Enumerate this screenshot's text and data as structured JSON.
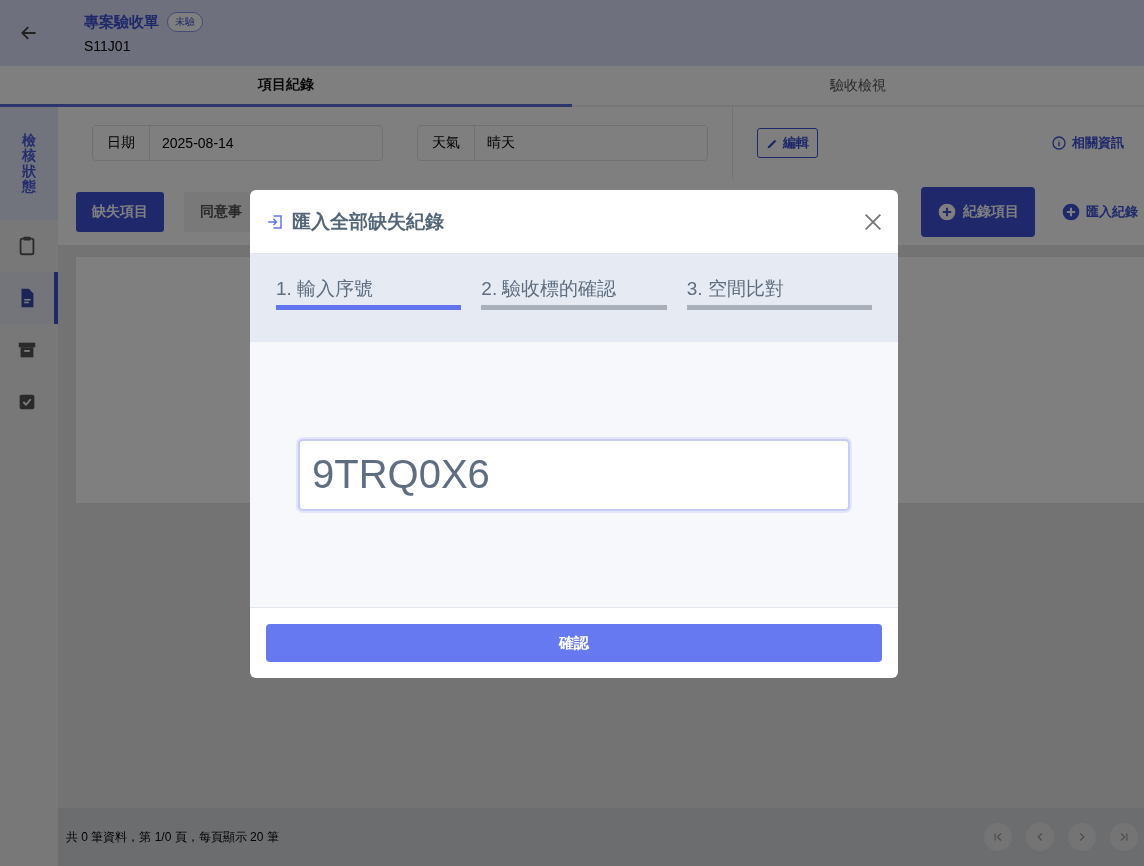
{
  "header": {
    "title": "專案驗收單",
    "badge": "未驗",
    "code": "S11J01"
  },
  "tabs": [
    {
      "label": "項目紀錄",
      "selected": true
    },
    {
      "label": "驗收檢視",
      "selected": false
    }
  ],
  "side_panel": {
    "label": "檢核狀態"
  },
  "sidebar_icons": [
    {
      "kind": "clipboard",
      "selected": false
    },
    {
      "kind": "document",
      "selected": true
    },
    {
      "kind": "archive",
      "selected": false
    },
    {
      "kind": "checklist",
      "selected": false
    }
  ],
  "fields": [
    {
      "label": "日期",
      "value": "2025-08-14"
    },
    {
      "label": "天氣",
      "value": "晴天"
    }
  ],
  "edit_button": "編輯",
  "info_link": "相關資訊",
  "filters": [
    {
      "label": "缺失項目",
      "selected": true
    },
    {
      "label": "同意事",
      "selected": false
    }
  ],
  "record_button": "紀錄項目",
  "import_link": "匯入紀錄",
  "footer": {
    "summary": "共 0 筆資料，第 1/0 頁，每頁顯示 20 筆",
    "pager": [
      {
        "kind": "first"
      },
      {
        "kind": "prev"
      },
      {
        "kind": "next"
      },
      {
        "kind": "last"
      }
    ]
  },
  "dialog": {
    "title": "匯入全部缺失紀錄",
    "steps": [
      {
        "label": "1. 輸入序號",
        "selected": true
      },
      {
        "label": "2. 驗收標的確認",
        "selected": false
      },
      {
        "label": "3. 空間比對",
        "selected": false
      }
    ],
    "serial_input": {
      "value": "9TRQ0X6"
    },
    "confirm_button": "確認"
  }
}
